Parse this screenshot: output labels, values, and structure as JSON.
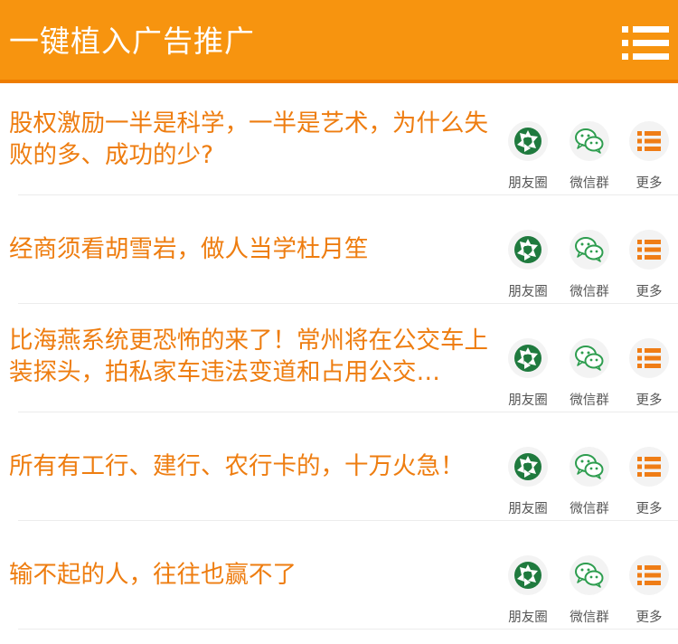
{
  "header": {
    "title": "一键植入广告推广",
    "menu_icon": "list-menu-icon"
  },
  "share_labels": {
    "moments": "朋友圈",
    "wechat_group": "微信群",
    "more": "更多"
  },
  "articles": [
    {
      "title": "股权激励一半是科学，一半是艺术，为什么失败的多、成功的少?"
    },
    {
      "title": "经商须看胡雪岩，做人当学杜月笙"
    },
    {
      "title": "比海燕系统更恐怖的来了！常州将在公交车上装探头，拍私家车违法变道和占用公交…"
    },
    {
      "title": "所有有工行、建行、农行卡的，十万火急！"
    },
    {
      "title": "输不起的人，往往也赢不了"
    }
  ],
  "colors": {
    "header_bg": "#f7940f",
    "title_text": "#ee7d10",
    "moments_icon": "#1f7a3e",
    "wechat_icon": "#2e9d4f",
    "more_icon": "#ef7d16"
  }
}
